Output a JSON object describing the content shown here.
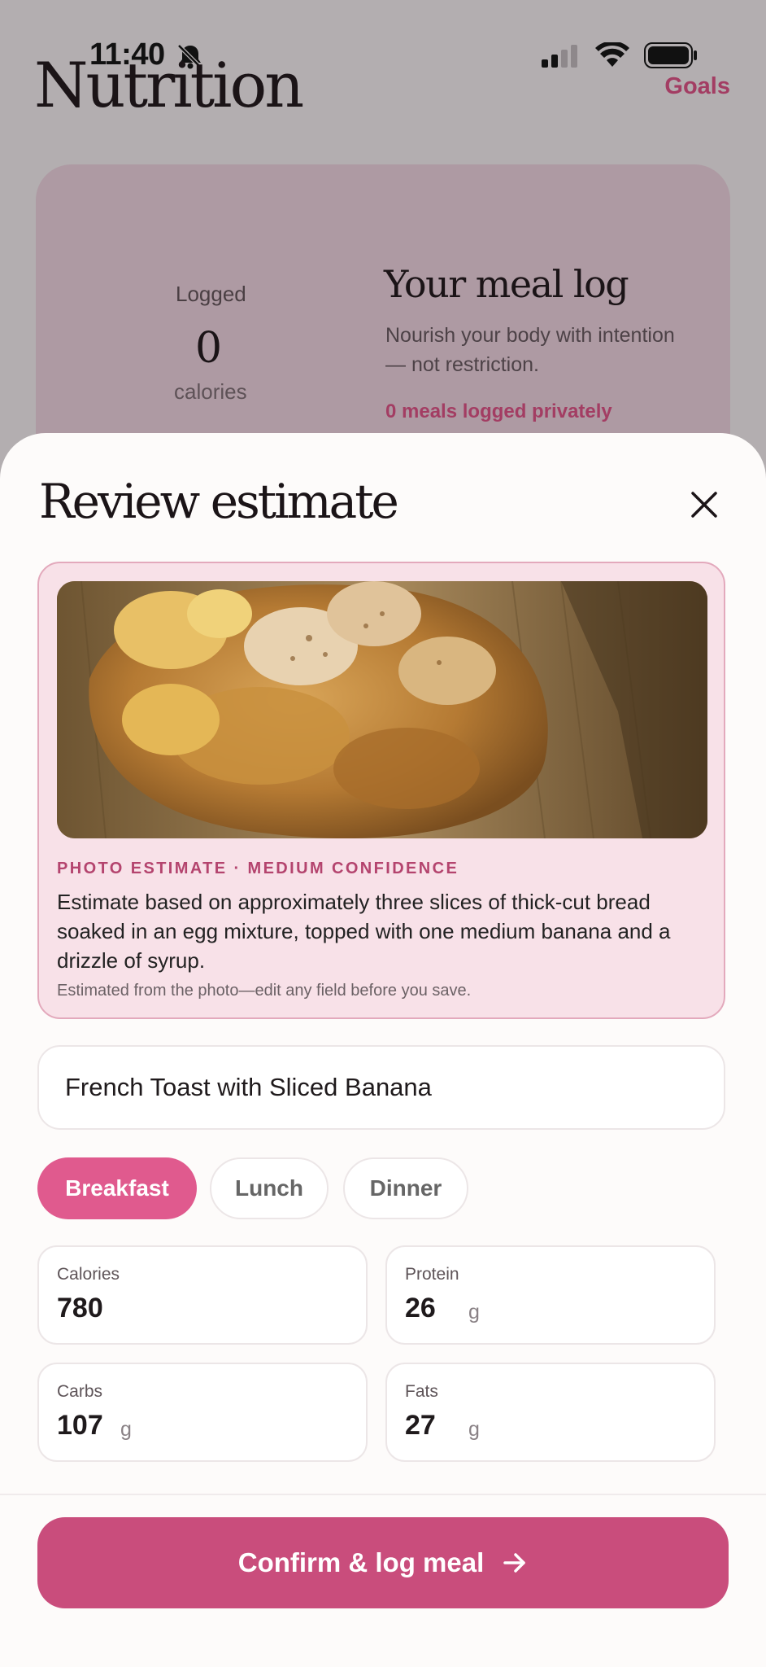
{
  "status_bar": {
    "time": "11:40"
  },
  "header": {
    "title": "Nutrition",
    "goals_label": "Goals"
  },
  "summary": {
    "logged_label": "Logged",
    "logged_value": "0",
    "logged_unit": "calories",
    "meal_log_title": "Your meal log",
    "meal_log_subtitle": "Nourish your body with intention — not restriction.",
    "meals_logged": "0 meals logged privately"
  },
  "sheet": {
    "title": "Review estimate",
    "estimate": {
      "label": "PHOTO ESTIMATE · MEDIUM CONFIDENCE",
      "description": "Estimate based on approximately three slices of thick-cut bread soaked in an egg mixture, topped with one medium banana and a drizzle of syrup.",
      "note": "Estimated from the photo—edit any field before you save."
    },
    "meal_name": "French Toast with Sliced Banana",
    "meal_types": [
      "Breakfast",
      "Lunch",
      "Dinner"
    ],
    "selected_meal_type": "Breakfast",
    "metrics": {
      "calories": {
        "label": "Calories",
        "value": "780"
      },
      "protein": {
        "label": "Protein",
        "value": "26",
        "unit": "g"
      },
      "carbs": {
        "label": "Carbs",
        "value": "107",
        "unit": "g"
      },
      "fats": {
        "label": "Fats",
        "value": "27",
        "unit": "g"
      }
    },
    "confirm_label": "Confirm & log meal"
  },
  "colors": {
    "accent": "#c94d7c",
    "chip_active": "#e05a8e",
    "estimate_bg": "#f8e1e8"
  }
}
